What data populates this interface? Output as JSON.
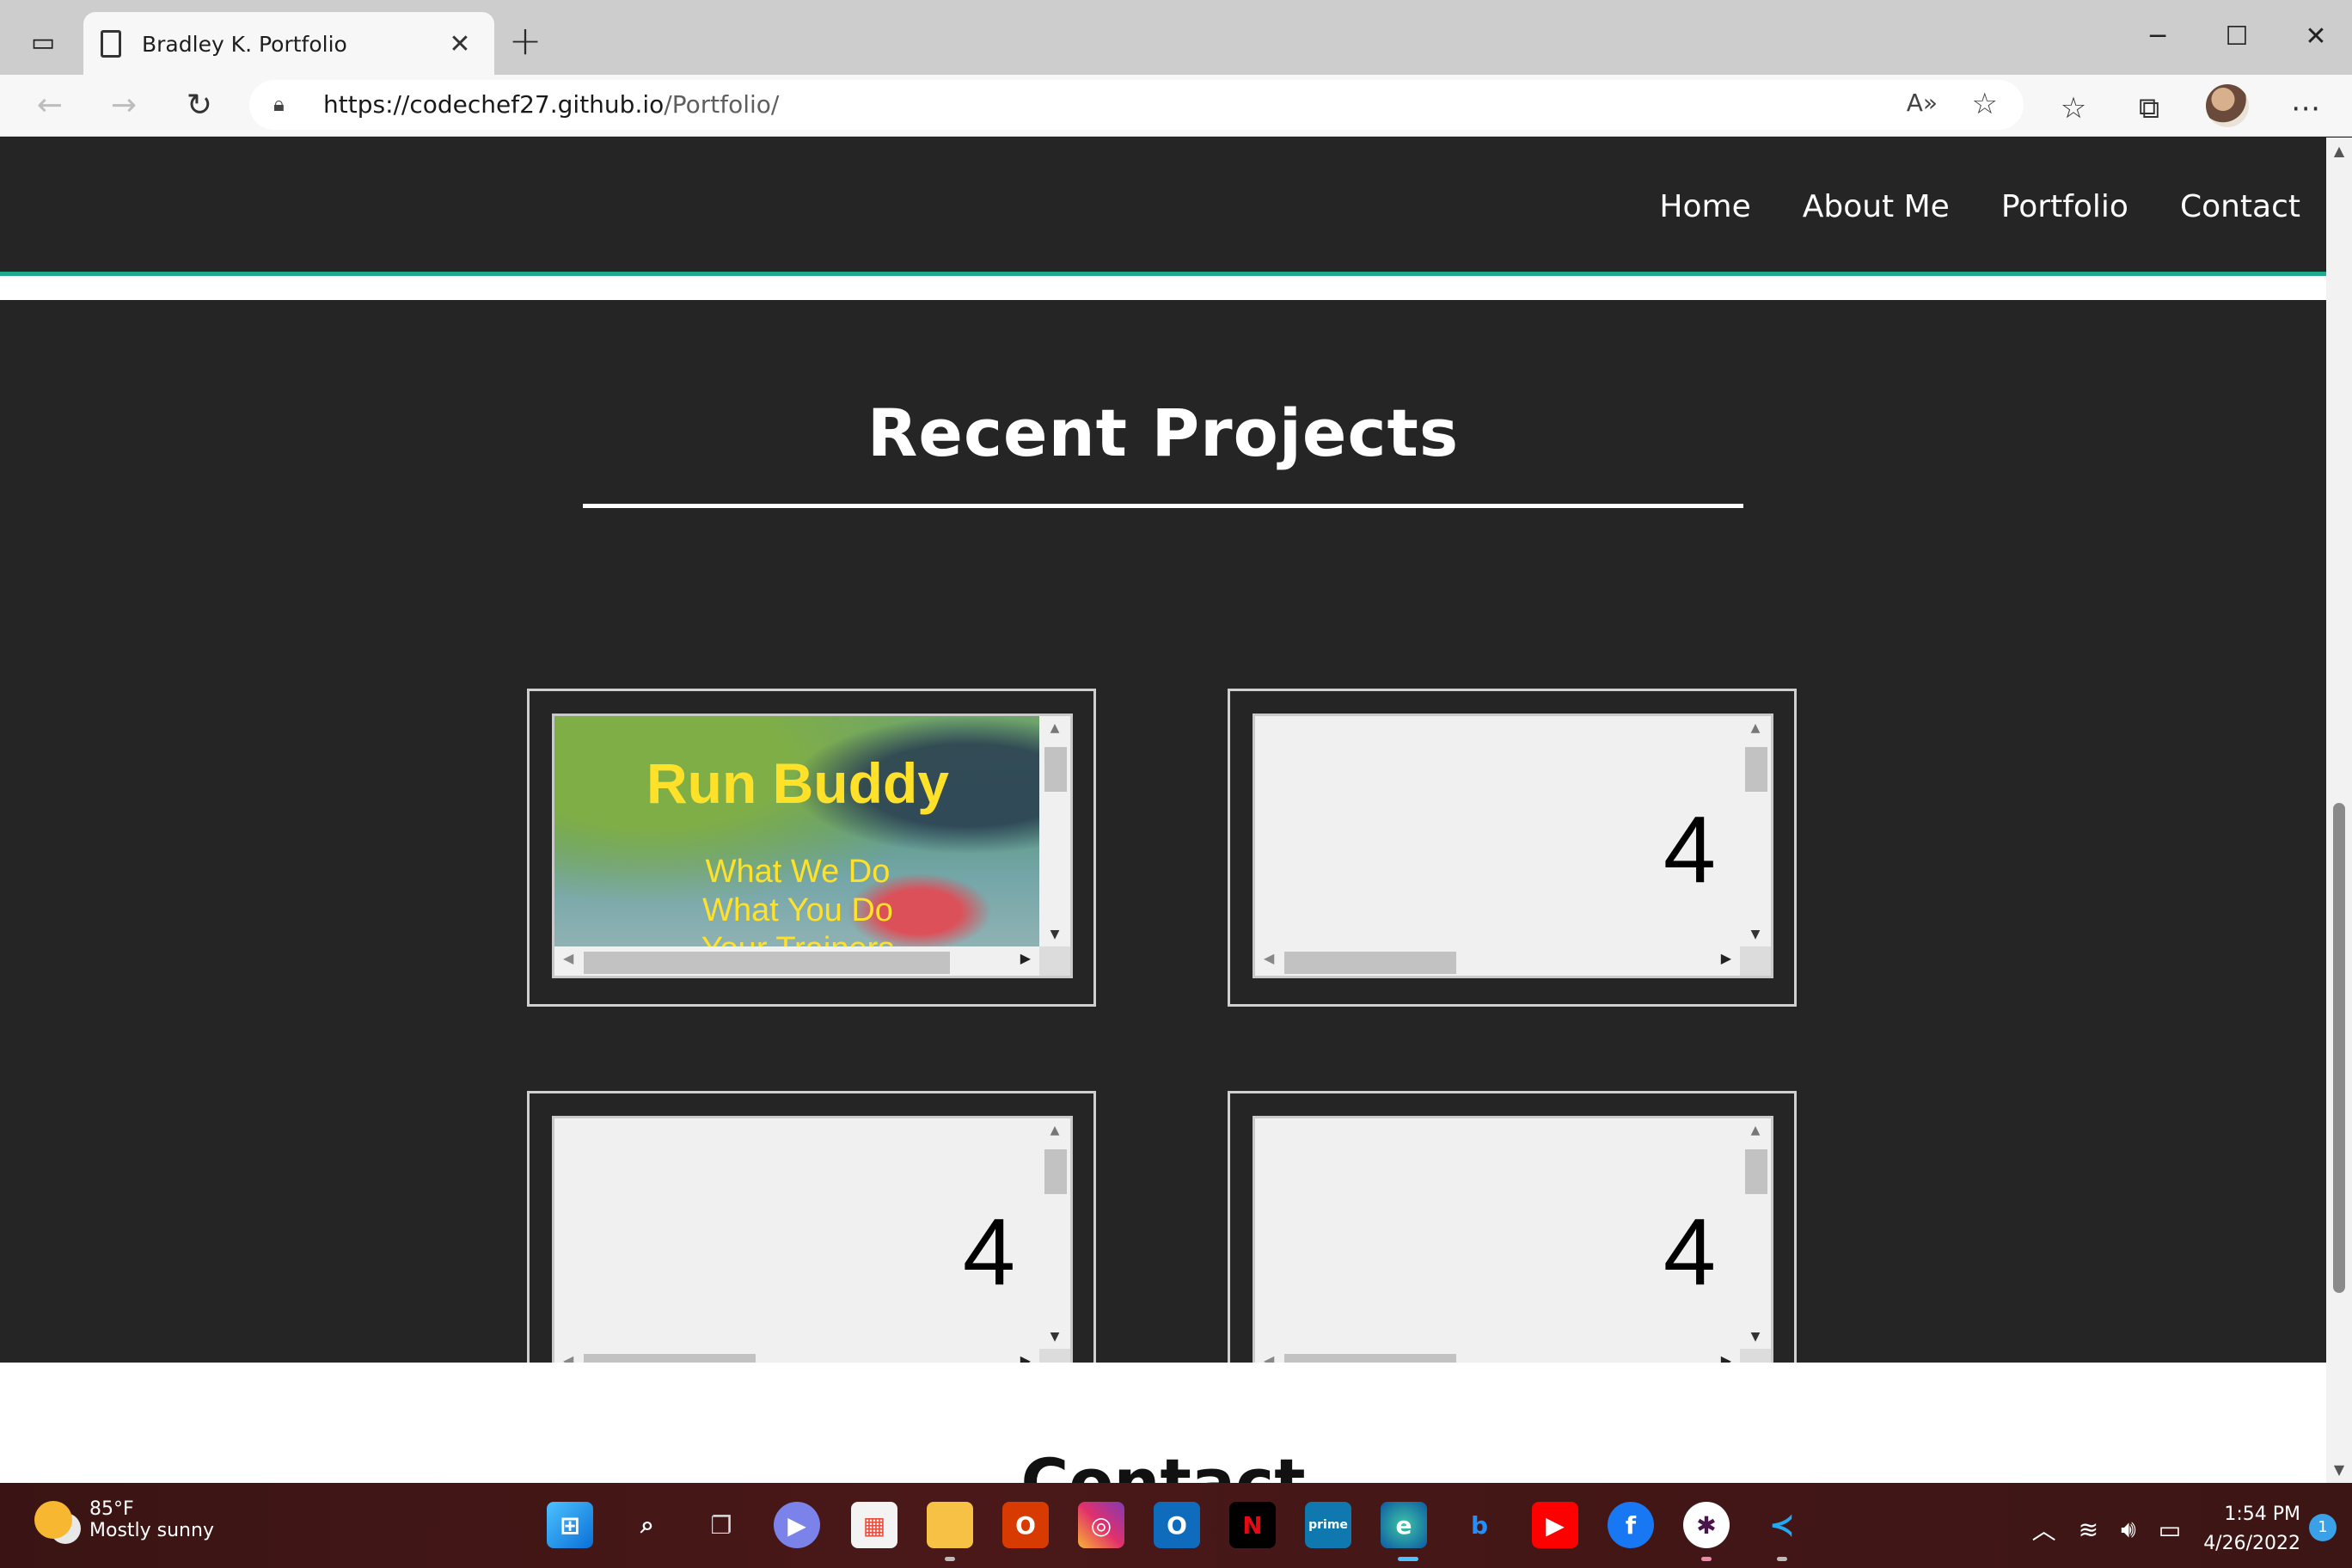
{
  "browser": {
    "tab_title": "Bradley K. Portfolio",
    "tab_close": "✕",
    "new_tab": "+",
    "url_host": "https://codechef27.github.io",
    "url_path": "/Portfolio/",
    "window_controls": {
      "minimize": "─",
      "maximize": "☐",
      "close": "✕"
    }
  },
  "site": {
    "nav": [
      {
        "label": "Home"
      },
      {
        "label": "About Me"
      },
      {
        "label": "Portfolio"
      },
      {
        "label": "Contact"
      }
    ],
    "accent_color": "#1fa98f",
    "projects": {
      "heading": "Recent Projects",
      "cards": [
        {
          "type": "run-buddy",
          "title": "Run Buddy",
          "lines": [
            "What We Do",
            "What You Do",
            "Your Trainers"
          ]
        },
        {
          "type": "placeholder",
          "value": "4"
        },
        {
          "type": "placeholder",
          "value": "4"
        },
        {
          "type": "placeholder",
          "value": "4"
        }
      ]
    },
    "contact": {
      "heading": "Contact"
    }
  },
  "taskbar": {
    "weather": {
      "temp": "85°F",
      "condition": "Mostly sunny"
    },
    "clock": {
      "time": "1:54 PM",
      "date": "4/26/2022"
    },
    "notification_count": "1",
    "apps": [
      "start",
      "search",
      "task-view",
      "teams-chat",
      "microsoft-store",
      "file-explorer",
      "office",
      "instagram",
      "outlook",
      "netflix",
      "prime-video",
      "edge",
      "bing",
      "youtube",
      "facebook",
      "slack",
      "vscode"
    ]
  }
}
